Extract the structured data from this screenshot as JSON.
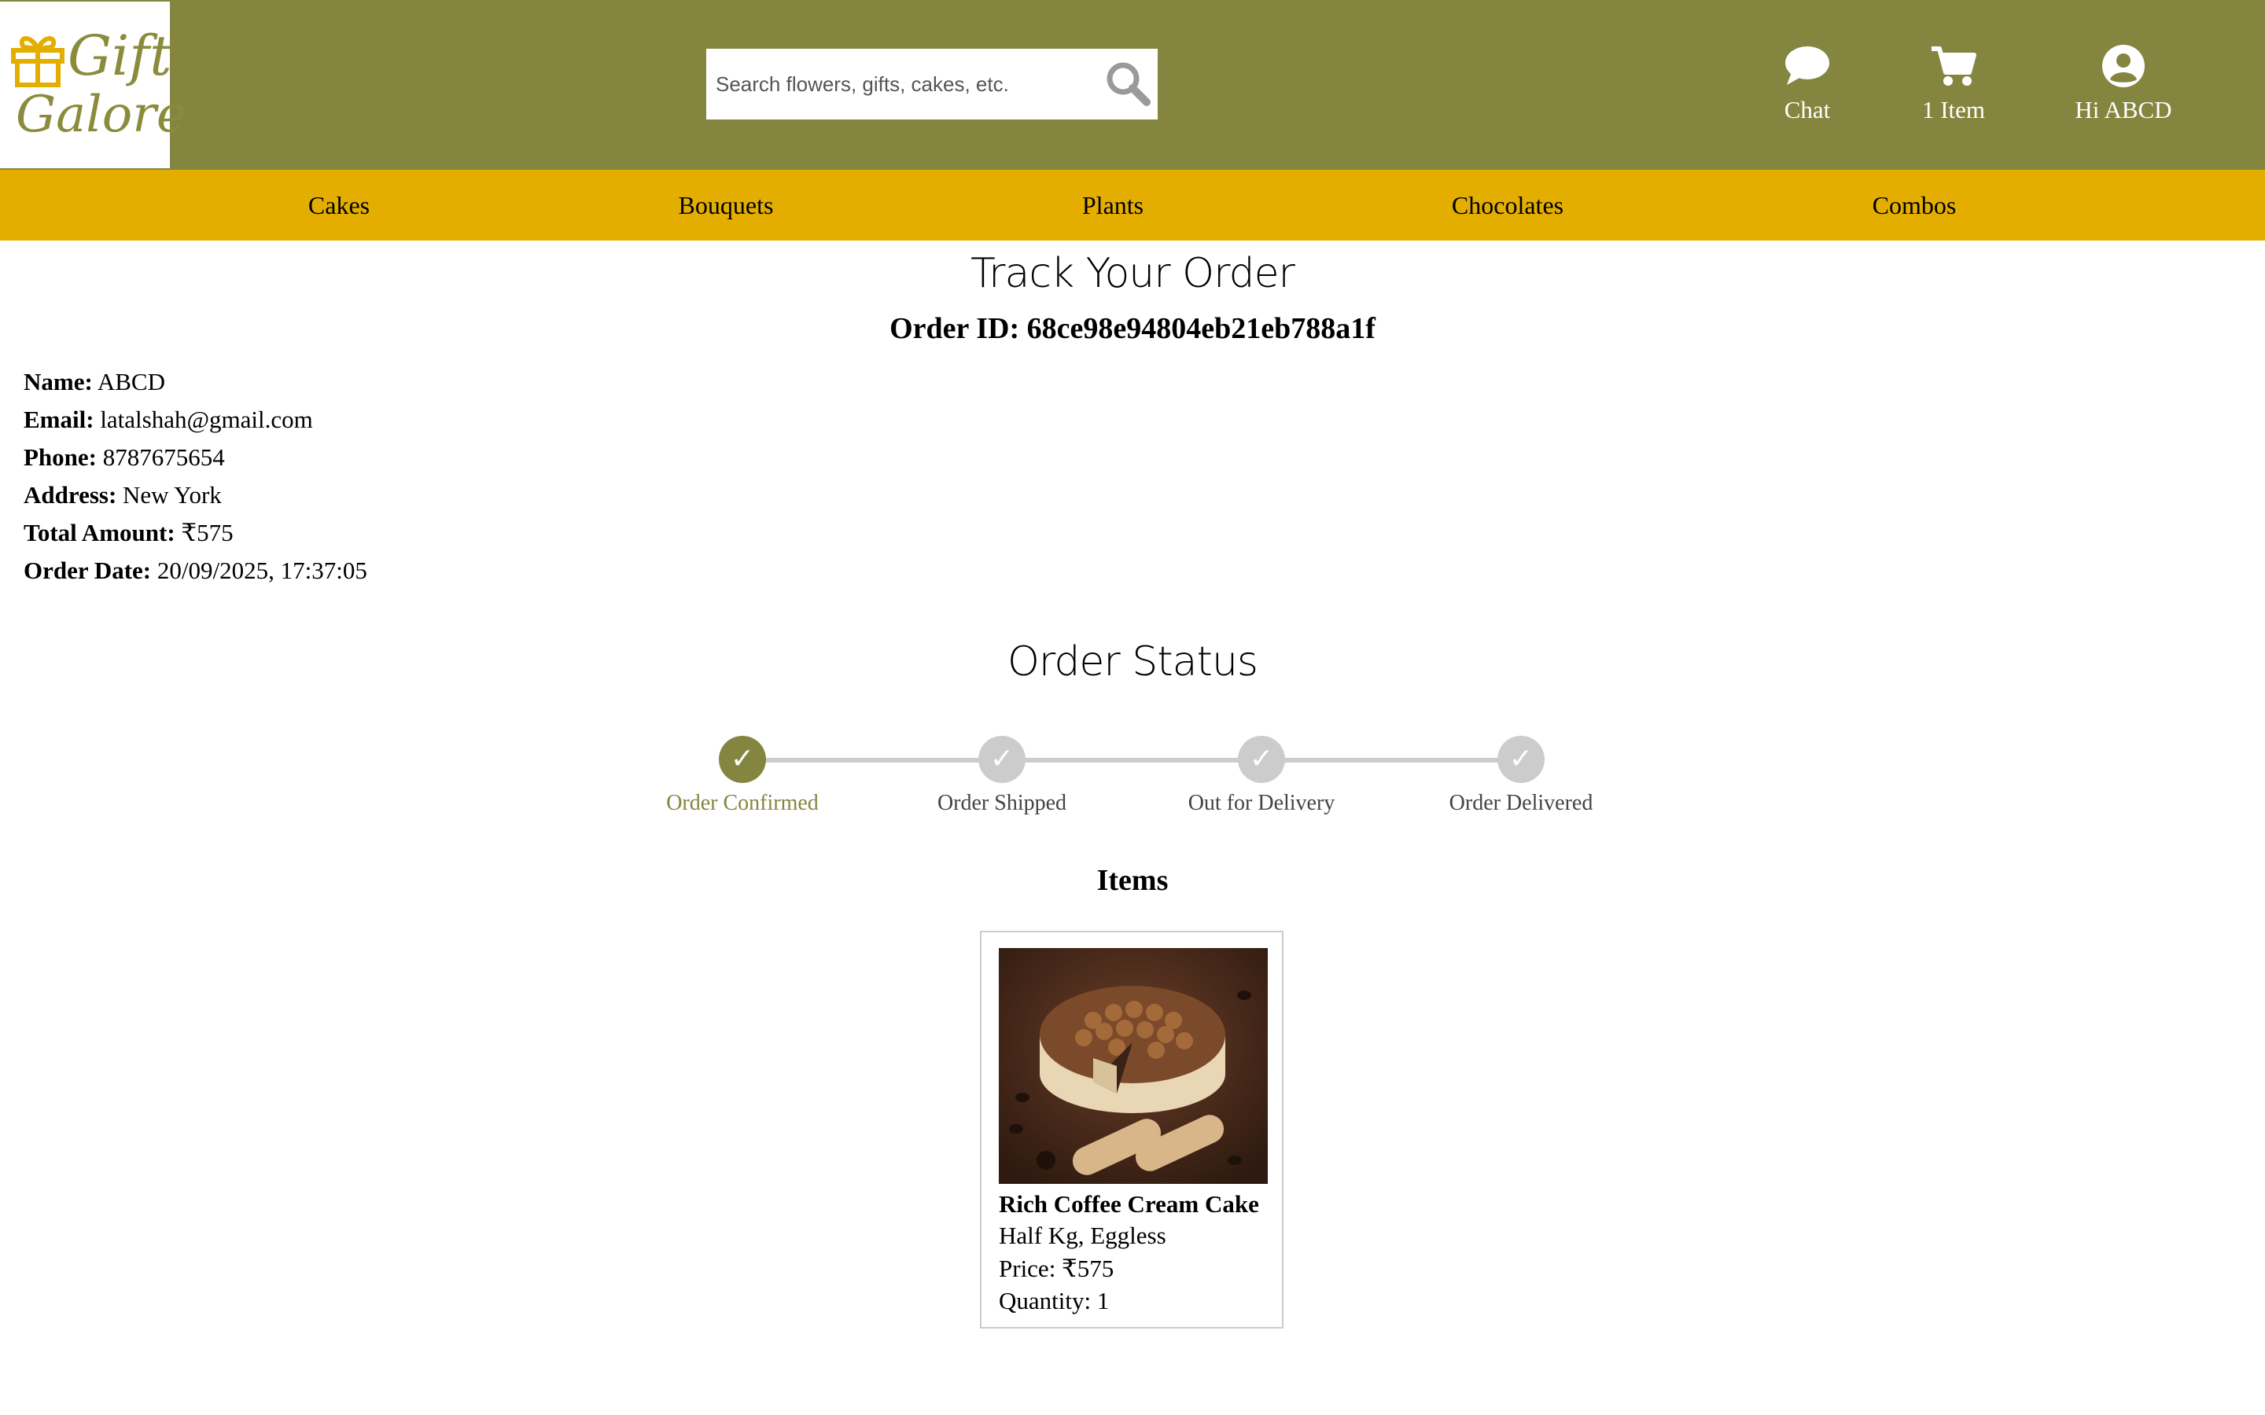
{
  "header": {
    "logo_line1": "Gift",
    "logo_line2": "Galore",
    "search_placeholder": "Search flowers, gifts, cakes, etc.",
    "chat_label": "Chat",
    "cart_label": "1 Item",
    "user_label": "Hi ABCD"
  },
  "categories": [
    "Cakes",
    "Bouquets",
    "Plants",
    "Chocolates",
    "Combos"
  ],
  "page": {
    "title": "Track Your Order",
    "order_id_label": "Order ID:",
    "order_id": "68ce98e94804eb21eb788a1f"
  },
  "customer": {
    "name_label": "Name:",
    "name": "ABCD",
    "email_label": "Email:",
    "email": "latalshah@gmail.com",
    "phone_label": "Phone:",
    "phone": "8787675654",
    "address_label": "Address:",
    "address": "New York",
    "total_label": "Total Amount:",
    "total": "₹575",
    "date_label": "Order Date:",
    "date": "20/09/2025, 17:37:05"
  },
  "status": {
    "title": "Order Status",
    "steps": [
      {
        "label": "Order Confirmed",
        "done": true
      },
      {
        "label": "Order Shipped",
        "done": false
      },
      {
        "label": "Out for Delivery",
        "done": false
      },
      {
        "label": "Order Delivered",
        "done": false
      }
    ],
    "check_glyph": "✓"
  },
  "items": {
    "title": "Items",
    "list": [
      {
        "name": "Rich Coffee Cream Cake",
        "variant": "Half Kg, Eggless",
        "price": "Price: ₹575",
        "quantity": "Quantity: 1"
      }
    ]
  },
  "colors": {
    "header_bg": "#848640",
    "nav_bg": "#e3ae00",
    "accent": "#848640",
    "inactive": "#cccccc"
  }
}
